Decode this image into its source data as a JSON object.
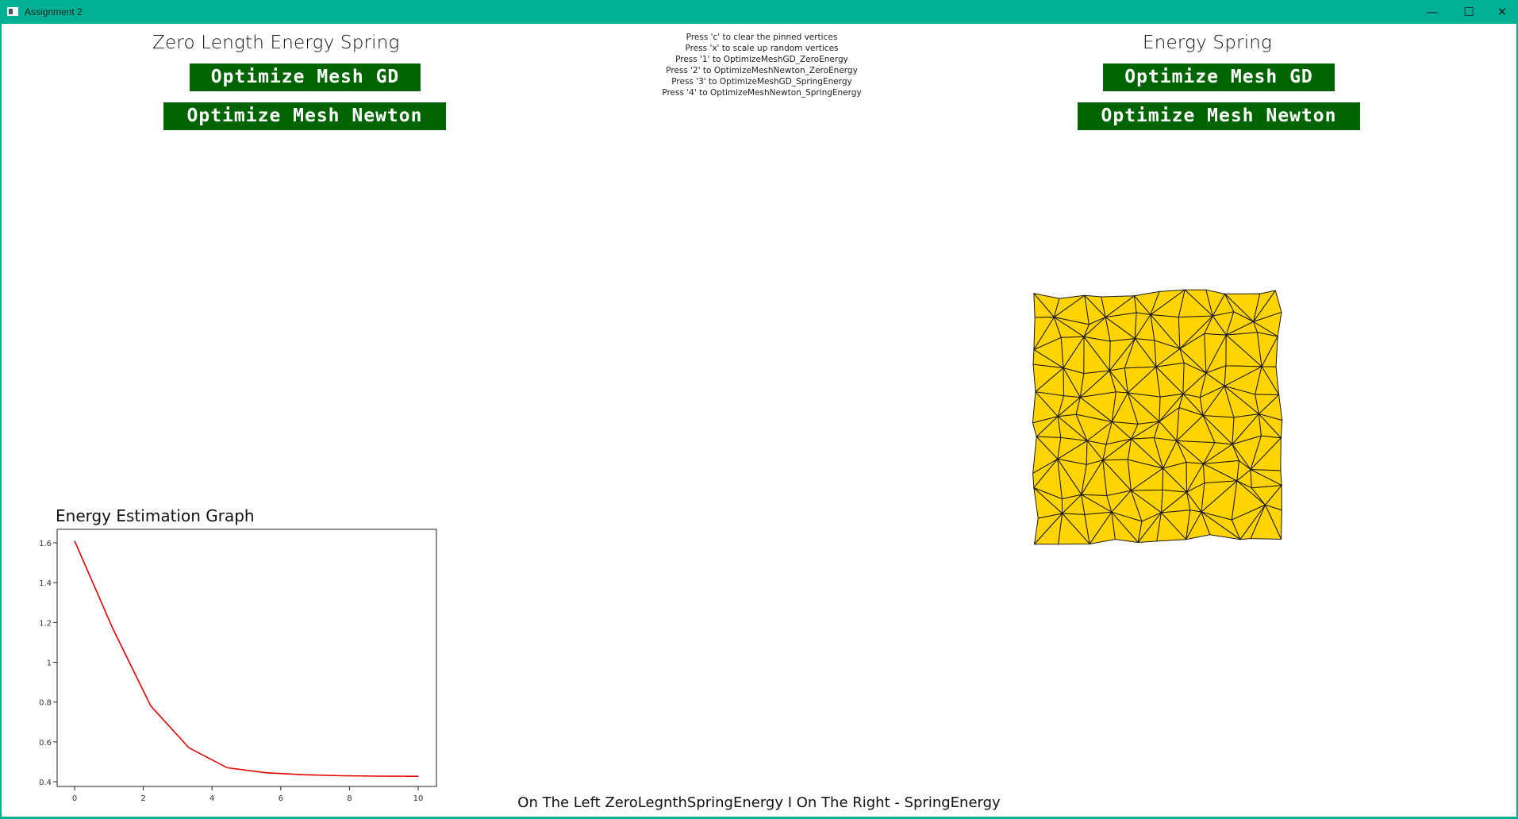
{
  "window": {
    "title": "Assignment 2",
    "minimize_glyph": "—",
    "maximize_glyph": "☐",
    "close_glyph": "✕"
  },
  "left_panel": {
    "title": "Zero Length Energy Spring",
    "gd_button": "Optimize Mesh GD",
    "newton_button": "Optimize Mesh Newton"
  },
  "right_panel": {
    "title": "Energy Spring",
    "gd_button": "Optimize Mesh GD",
    "newton_button": "Optimize Mesh Newton"
  },
  "instructions": [
    "Press 'c' to clear the pinned vertices",
    "Press 'x' to scale up random vertices",
    "Press '1' to OptimizeMeshGD_ZeroEnergy",
    "Press '2' to OptimizeMeshNewton_ZeroEnergy",
    "Press '3' to OptimizeMeshGD_SpringEnergy",
    "Press '4' to OptimizeMeshNewton_SpringEnergy"
  ],
  "graph_title": "Energy Estimation Graph",
  "footer": "On The Left ZeroLegnthSpringEnergy I On The Right - SpringEnergy",
  "colors": {
    "titlebar": "#00b094",
    "button_bg": "#006400",
    "mesh_fill": "#ffd400",
    "mesh_edge": "#1a1a1a",
    "line": "#e00000"
  },
  "chart_data": {
    "type": "line",
    "title": "Energy Estimation Graph",
    "xlabel": "",
    "ylabel": "",
    "xlim": [
      0,
      10
    ],
    "ylim": [
      0.4,
      1.65
    ],
    "x_ticks": [
      0,
      2,
      4,
      6,
      8,
      10
    ],
    "y_ticks": [
      0.4,
      0.6,
      0.8,
      1,
      1.2,
      1.4,
      1.6
    ],
    "grid": false,
    "series": [
      {
        "x": [
          0,
          1.11,
          2.22,
          3.33,
          4.44,
          5.56,
          6.67,
          7.78,
          8.89,
          10
        ],
        "y": [
          1.61,
          1.17,
          0.78,
          0.57,
          0.47,
          0.445,
          0.435,
          0.43,
          0.428,
          0.427
        ],
        "color": "#e00000"
      }
    ]
  }
}
